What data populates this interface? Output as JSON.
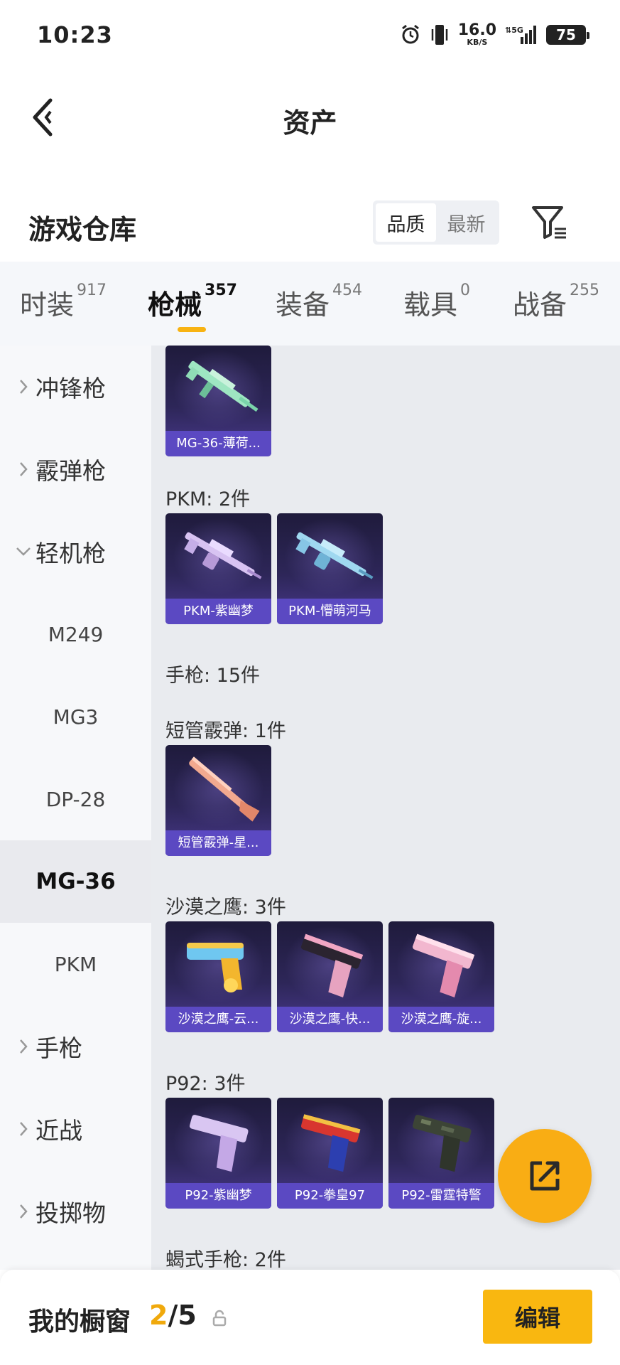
{
  "status_bar": {
    "time": "10:23",
    "net_speed_value": "16.0",
    "net_speed_unit": "KB/S",
    "network": "5G",
    "battery": "75",
    "icons": [
      "alarm-icon",
      "vibrate-icon",
      "wifi-arrows-icon",
      "signal-icon",
      "battery-icon"
    ]
  },
  "nav": {
    "title": "资产",
    "back_icon": "back-arrow-icon"
  },
  "warehouse": {
    "title": "游戏仓库",
    "sort_options": [
      "品质",
      "最新"
    ],
    "active_sort": "品质",
    "filter_icon": "filter-icon"
  },
  "categories": [
    {
      "label": "时装",
      "count": "917"
    },
    {
      "label": "枪械",
      "count": "357"
    },
    {
      "label": "装备",
      "count": "454"
    },
    {
      "label": "载具",
      "count": "0"
    },
    {
      "label": "战备",
      "count": "255"
    }
  ],
  "active_category": "枪械",
  "sidebar": {
    "groups": [
      {
        "label": "冲锋枪",
        "expanded": false
      },
      {
        "label": "霰弹枪",
        "expanded": false
      },
      {
        "label": "轻机枪",
        "expanded": true
      }
    ],
    "subitems": [
      "M249",
      "MG3",
      "DP-28",
      "MG-36",
      "PKM"
    ],
    "selected_subitem": "MG-36",
    "more_groups": [
      {
        "label": "手枪",
        "expanded": false
      },
      {
        "label": "近战",
        "expanded": false
      },
      {
        "label": "投掷物",
        "expanded": false
      }
    ]
  },
  "content": {
    "groups": [
      {
        "title": "",
        "items": [
          {
            "name": "MG-36-薄荷...",
            "art": "rifle-mint"
          }
        ]
      },
      {
        "title": "PKM: 2件",
        "items": [
          {
            "name": "PKM-紫幽梦",
            "art": "mg-purple"
          },
          {
            "name": "PKM-懵萌河马",
            "art": "mg-blue"
          }
        ]
      },
      {
        "title": "手枪: 15件",
        "items": []
      },
      {
        "title": "短管霰弹: 1件",
        "items": [
          {
            "name": "短管霰弹-星...",
            "art": "shotgun-pink"
          }
        ]
      },
      {
        "title": "沙漠之鹰: 3件",
        "items": [
          {
            "name": "沙漠之鹰-云...",
            "art": "pistol-toy"
          },
          {
            "name": "沙漠之鹰-快...",
            "art": "pistol-pink-dark"
          },
          {
            "name": "沙漠之鹰-旋...",
            "art": "pistol-pink"
          }
        ]
      },
      {
        "title": "P92: 3件",
        "items": [
          {
            "name": "P92-紫幽梦",
            "art": "pistol-lavender"
          },
          {
            "name": "P92-拳皇97",
            "art": "pistol-red-blue"
          },
          {
            "name": "P92-雷霆特警",
            "art": "pistol-camo"
          }
        ]
      },
      {
        "title": "蝎式手枪: 2件",
        "items": []
      }
    ]
  },
  "fab": {
    "icon": "share-external-icon"
  },
  "bottom_bar": {
    "label": "我的橱窗",
    "current": "2",
    "slash": "/",
    "total": "5",
    "lock_icon": "lock-icon",
    "edit_label": "编辑"
  }
}
